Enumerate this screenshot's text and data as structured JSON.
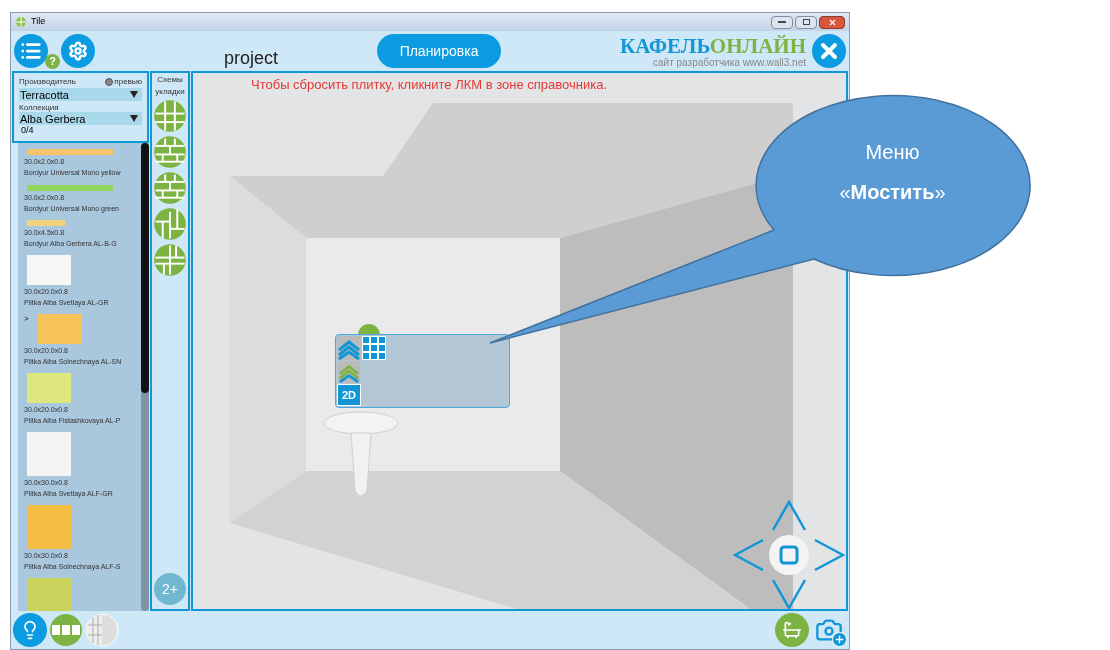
{
  "window": {
    "title": "Tile"
  },
  "header": {
    "help_badge": "?",
    "project_name": "project",
    "planning_button": "Планировка",
    "logo": {
      "part1": "КАФЕЛЬ",
      "part2": "ОНЛАЙН",
      "subtitle": "сайт разработчика www.wall3.net"
    }
  },
  "sidebar": {
    "manufacturer_label": "Производитель",
    "preview_label": "превью",
    "preview_checked": false,
    "manufacturer": "Terracotta",
    "collection_label": "Коллекция",
    "collection": "Alba Gerbera",
    "count": "0/4",
    "tiles": [
      {
        "kind": "strip",
        "color": "#f8c266",
        "size": "30.0x2.0x0.8",
        "name": "Bordyur Universal Mono yellow"
      },
      {
        "kind": "strip",
        "color": "#8fd65a",
        "size": "30.0x2.0x0.8",
        "name": "Bordyur Universal Mono green"
      },
      {
        "kind": "border",
        "color": "#f2d27a",
        "size": "30.0x4.5x0.8",
        "name": "Bordyur Alba Gerbera AL-B-G"
      },
      {
        "kind": "tile",
        "color": "#f6f6f4",
        "size": "30.0x20.0x0.8",
        "name": "Plitka Alba Svetlaya AL-GR"
      },
      {
        "kind": "tile",
        "color": "#f7c45a",
        "marker": ">",
        "size": "30.0x20.0x0.8",
        "name": "Plitka Alba Solnechnaya AL-SN"
      },
      {
        "kind": "tile",
        "color": "#dde77e",
        "size": "30.0x20.0x0.8",
        "name": "Plitka Alba Fistashkovaya AL-P"
      },
      {
        "kind": "tall",
        "color": "#f4f4f2",
        "size": "30.0x30.0x0.8",
        "name": "Plitka Alba Svetlaya ALF-GR"
      },
      {
        "kind": "tall",
        "color": "#f6bd45",
        "size": "30.0x30.0x0.8",
        "name": "Plitka Alba Solnechnaya ALF-S"
      },
      {
        "kind": "tall",
        "color": "#c9d25a"
      }
    ]
  },
  "schemes": {
    "title_line1": "Схемы",
    "title_line2": "укладки",
    "more_button": "2+"
  },
  "viewport": {
    "hint": "Чтобы сбросить плитку, кликните ЛКМ в зоне справочника.",
    "menu": {
      "mode_button": "2D"
    }
  },
  "callout": {
    "line1": "Меню",
    "line2": "«**Мостить**»"
  }
}
